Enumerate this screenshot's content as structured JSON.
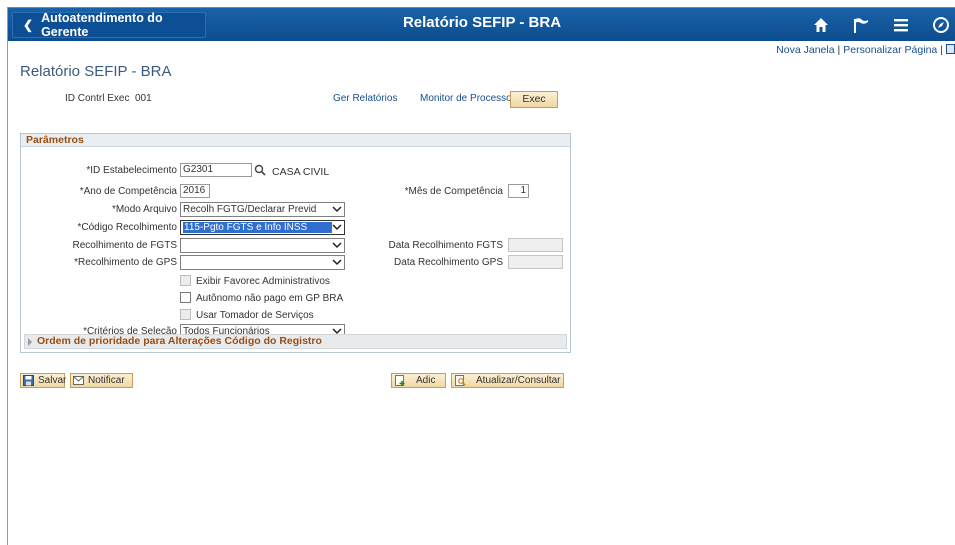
{
  "header": {
    "back_label": "Autoatendimento do Gerente",
    "title": "Relatório SEFIP - BRA",
    "icons": [
      "home-icon",
      "flag-icon",
      "menu-icon",
      "compass-icon"
    ]
  },
  "top_links": {
    "new_window": "Nova Janela",
    "separator": "|",
    "customize": "Personalizar Página"
  },
  "page_title": "Relatório SEFIP - BRA",
  "run_control": {
    "label": "ID Contrl Exec",
    "value": "001",
    "report_manager": "Ger Relatórios",
    "process_monitor": "Monitor de Processos",
    "exec_button": "Exec"
  },
  "parameters": {
    "title": "Parâmetros",
    "establishment_label": "*ID Estabelecimento",
    "establishment_value": "G2301",
    "establishment_desc": "CASA CIVIL",
    "year_label": "*Ano de Competência",
    "year_value": "2016",
    "month_label": "*Mês de Competência",
    "month_value": "1",
    "file_mode_label": "*Modo Arquivo",
    "file_mode_value": "Recolh FGTG/Declarar Previd",
    "collection_code_label": "*Código Recolhimento",
    "collection_code_value": "115-Pgto FGTS e Info INSS",
    "fgts_label": "Recolhimento de FGTS",
    "fgts_value": "",
    "fgts_date_label": "Data Recolhimento FGTS",
    "fgts_date_value": "",
    "gps_label": "*Recolhimento de GPS",
    "gps_value": "",
    "gps_date_label": "Data Recolhimento GPS",
    "gps_date_value": "",
    "cb_show_admin": "Exibir Favorec Administrativos",
    "cb_autonomo": "Autônomo não pago em GP BRA",
    "cb_tomador": "Usar Tomador de Serviços",
    "criteria_label": "*Critérios de Seleção",
    "criteria_value": "Todos Funcionários",
    "priority_section": "Ordem de prioridade para Alterações Código do Registro"
  },
  "toolbar": {
    "save": "Salvar",
    "notify": "Notificar",
    "add": "Adic",
    "update": "Atualizar/Consultar"
  },
  "colors": {
    "header_bg": "#0c4d8e",
    "section_title": "#9c4d10",
    "link": "#1a4f8a",
    "selection": "#2f6fd0"
  }
}
